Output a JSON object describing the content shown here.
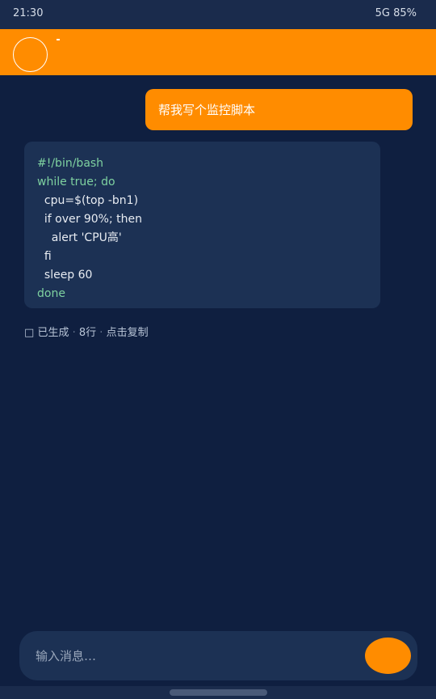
{
  "status_bar": {
    "time": "21:30",
    "system": "5G 85%"
  },
  "colors": {
    "accent": "#ff8c00",
    "background": "#0f1f40",
    "bubble": "#1c3154",
    "code_keyword": "#7ed1a0"
  },
  "header": {
    "avatar_icon": "avatar-circle-icon"
  },
  "messages": {
    "user_text": "帮我写个监控脚本",
    "code_lines": [
      "#!/bin/bash",
      "while true; do",
      "  cpu=$(top -bn1)",
      "  if over 90%; then",
      "    alert 'CPU高'",
      "  fi",
      "  sleep 60",
      "done"
    ],
    "meta": {
      "icon": "□",
      "status": "已生成",
      "sep": "·",
      "lines": "8行",
      "copy": "点击复制"
    }
  },
  "composer": {
    "placeholder": "输入消息…"
  }
}
